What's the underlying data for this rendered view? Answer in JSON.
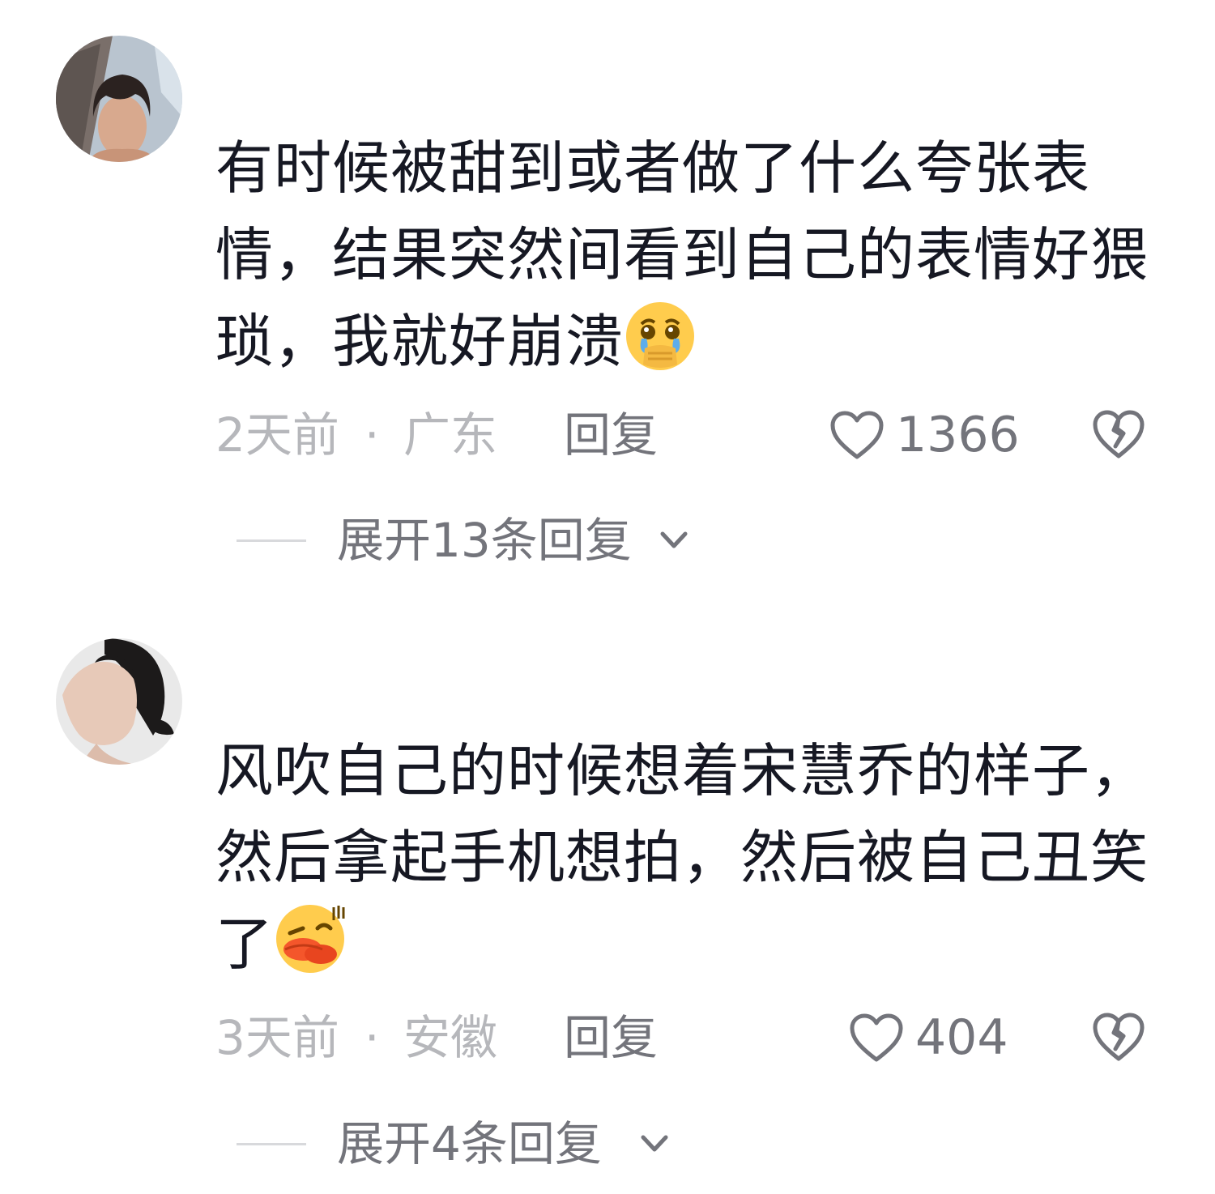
{
  "comments": [
    {
      "avatar": "avatar-cg-boy",
      "text": "有时候被甜到或者做了什么夸张表情，结果突然间看到自己的表情好猥琐，我就好崩溃",
      "emoji": "crying-face-icon",
      "time": "2天前",
      "separator": "·",
      "location": "广东",
      "reply_label": "回复",
      "likes": "1366",
      "expand_label": "展开13条回复"
    },
    {
      "avatar": "avatar-woman-profile",
      "text": "风吹自己的时候想着宋慧乔的样子，然后拿起手机想拍，然后被自己丑笑了",
      "emoji": "duck-face-icon",
      "time": "3天前",
      "separator": "·",
      "location": "安徽",
      "reply_label": "回复",
      "likes": "404",
      "expand_label": "展开4条回复"
    }
  ],
  "colors": {
    "text_primary": "#161823",
    "text_meta": "#b6b7bb",
    "text_secondary": "#73747b",
    "divider": "#d8d9dc"
  }
}
